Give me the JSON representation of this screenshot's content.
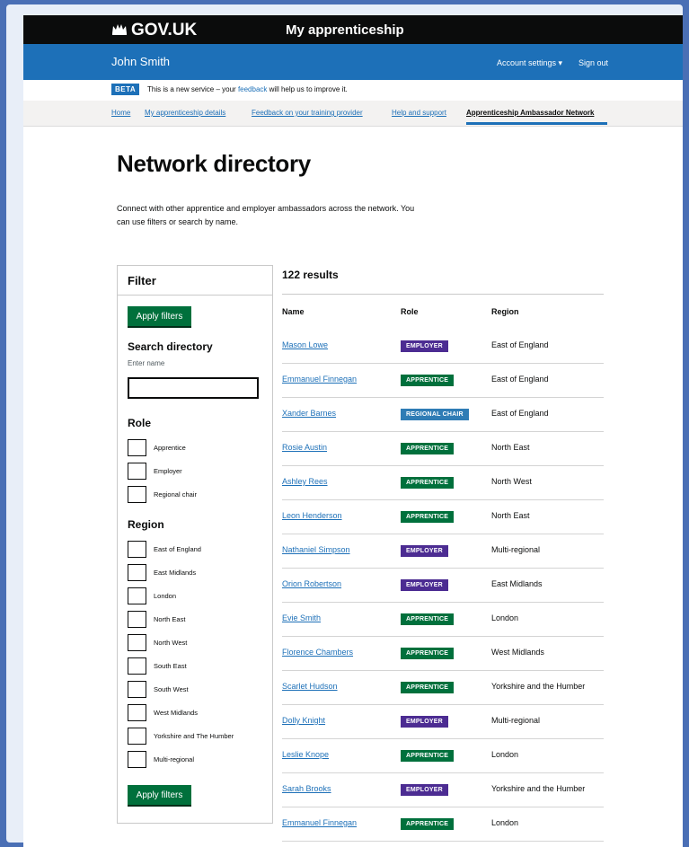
{
  "header": {
    "logo_text": "GOV.UK",
    "service_name": "My apprenticeship",
    "user_name": "John Smith",
    "account_settings": "Account settings ▾",
    "sign_out": "Sign out",
    "crown_icon": "crown-icon"
  },
  "beta": {
    "tag": "BETA",
    "text_before": "This is a new service – your ",
    "link": "feedback",
    "text_after": " will help us to improve it."
  },
  "nav": {
    "items": [
      {
        "label": "Home"
      },
      {
        "label": "My apprenticeship details"
      },
      {
        "label": "Feedback on your training provider"
      },
      {
        "label": "Help and support"
      },
      {
        "label": "Apprenticeship Ambassador Network"
      }
    ],
    "active_index": 4
  },
  "page": {
    "title": "Network directory",
    "intro": "Connect with other apprentice and employer ambassadors across the network. You can use filters or search by name."
  },
  "filter": {
    "title": "Filter",
    "apply_label": "Apply filters",
    "search_label": "Search directory",
    "search_hint": "Enter name",
    "search_value": "",
    "role_title": "Role",
    "roles": [
      "Apprentice",
      "Employer",
      "Regional chair"
    ],
    "region_title": "Region",
    "regions": [
      "East of England",
      "East Midlands",
      "London",
      "North East",
      "North West",
      "South East",
      "South West",
      "West Midlands",
      "Yorkshire and The Humber",
      "Multi-regional"
    ]
  },
  "results": {
    "count_text": "122 results",
    "headers": {
      "name": "Name",
      "role": "Role",
      "region": "Region"
    },
    "rows": [
      {
        "name": "Mason Lowe",
        "role": "EMPLOYER",
        "region": "East of England"
      },
      {
        "name": "Emmanuel Finnegan",
        "role": "APPRENTICE",
        "region": "East of England"
      },
      {
        "name": "Xander Barnes",
        "role": "REGIONAL CHAIR",
        "region": "East of England"
      },
      {
        "name": "Rosie Austin",
        "role": "APPRENTICE",
        "region": "North East"
      },
      {
        "name": "Ashley Rees",
        "role": "APPRENTICE",
        "region": "North West"
      },
      {
        "name": "Leon Henderson",
        "role": "APPRENTICE",
        "region": "North East"
      },
      {
        "name": "Nathaniel Simpson",
        "role": "EMPLOYER",
        "region": "Multi-regional"
      },
      {
        "name": "Orion Robertson",
        "role": "EMPLOYER",
        "region": "East Midlands"
      },
      {
        "name": "Evie Smith",
        "role": "APPRENTICE",
        "region": "London"
      },
      {
        "name": "Florence Chambers",
        "role": "APPRENTICE",
        "region": "West Midlands"
      },
      {
        "name": "Scarlet Hudson",
        "role": "APPRENTICE",
        "region": "Yorkshire and the Humber"
      },
      {
        "name": "Dolly Knight",
        "role": "EMPLOYER",
        "region": "Multi-regional"
      },
      {
        "name": "Leslie Knope",
        "role": "APPRENTICE",
        "region": "London"
      },
      {
        "name": "Sarah Brooks",
        "role": "EMPLOYER",
        "region": "Yorkshire and the Humber"
      },
      {
        "name": "Emmanuel Finnegan",
        "role": "APPRENTICE",
        "region": "London"
      }
    ]
  },
  "colors": {
    "header_black": "#0b0c0c",
    "brand_blue": "#1d70b8",
    "button_green": "#00703c",
    "tag_employer": "#4c2c92",
    "tag_apprentice": "#00703c",
    "tag_regional_chair": "#2f7cb5"
  }
}
